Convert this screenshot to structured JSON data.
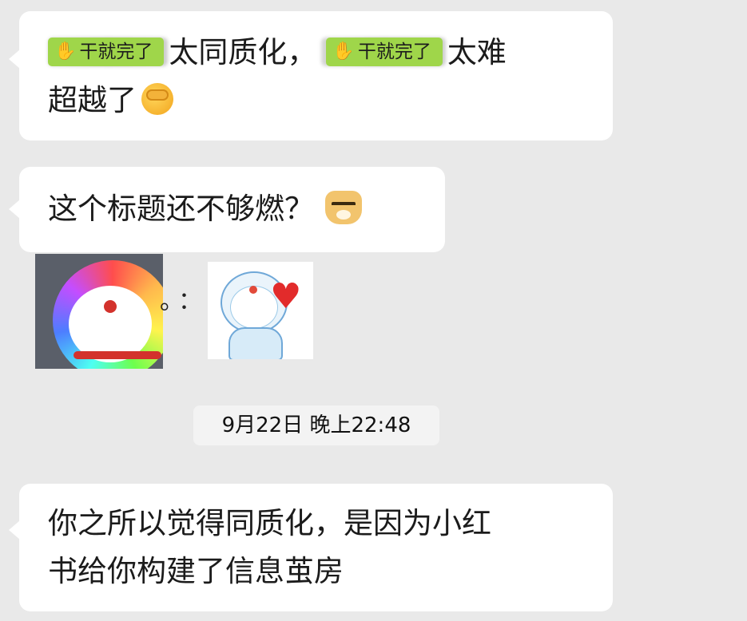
{
  "messages": [
    {
      "id": "m1",
      "line1_seg1": "太同质化，",
      "line1_seg2": "太难",
      "line2": "超越了",
      "stickers": [
        "干就完了",
        "干就完了"
      ],
      "emoji": "facepalm-emoji"
    },
    {
      "id": "m2",
      "text": "这个标题还不够燃？",
      "emoji": "doge-emoji"
    },
    {
      "id": "m3",
      "line1": "你之所以觉得同质化，是因为小红",
      "line2": "书给你构建了信息茧房"
    }
  ],
  "image_row": {
    "separator": "。："
  },
  "timestamp": "9月22日 晚上22:48",
  "colors": {
    "background": "#e9e9e9",
    "bubble": "#ffffff",
    "sticker": "#9fd64a",
    "heart": "#e22b2b"
  }
}
